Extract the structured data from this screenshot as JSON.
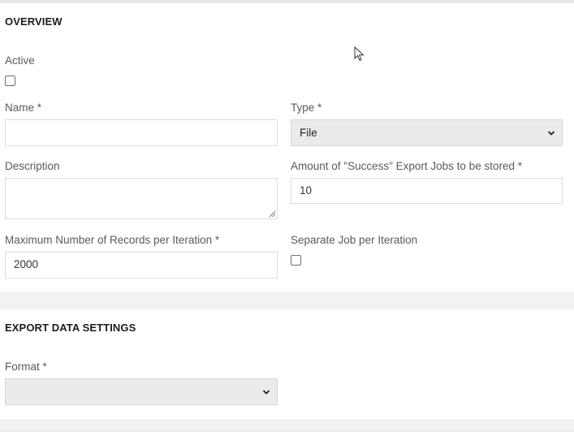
{
  "overview": {
    "title": "OVERVIEW",
    "active_label": "Active",
    "name_label": "Name *",
    "name_value": "",
    "type_label": "Type *",
    "type_value": "File",
    "description_label": "Description",
    "description_value": "",
    "amount_label": "Amount of \"Success\" Export Jobs to be stored *",
    "amount_value": "10",
    "max_records_label": "Maximum Number of Records per Iteration *",
    "max_records_value": "2000",
    "separate_job_label": "Separate Job per Iteration"
  },
  "export_settings": {
    "title": "EXPORT DATA SETTINGS",
    "format_label": "Format *",
    "format_value": ""
  },
  "icons": {
    "select_arrow": "chevron-down-icon",
    "cursor": "mouse-pointer-icon"
  }
}
